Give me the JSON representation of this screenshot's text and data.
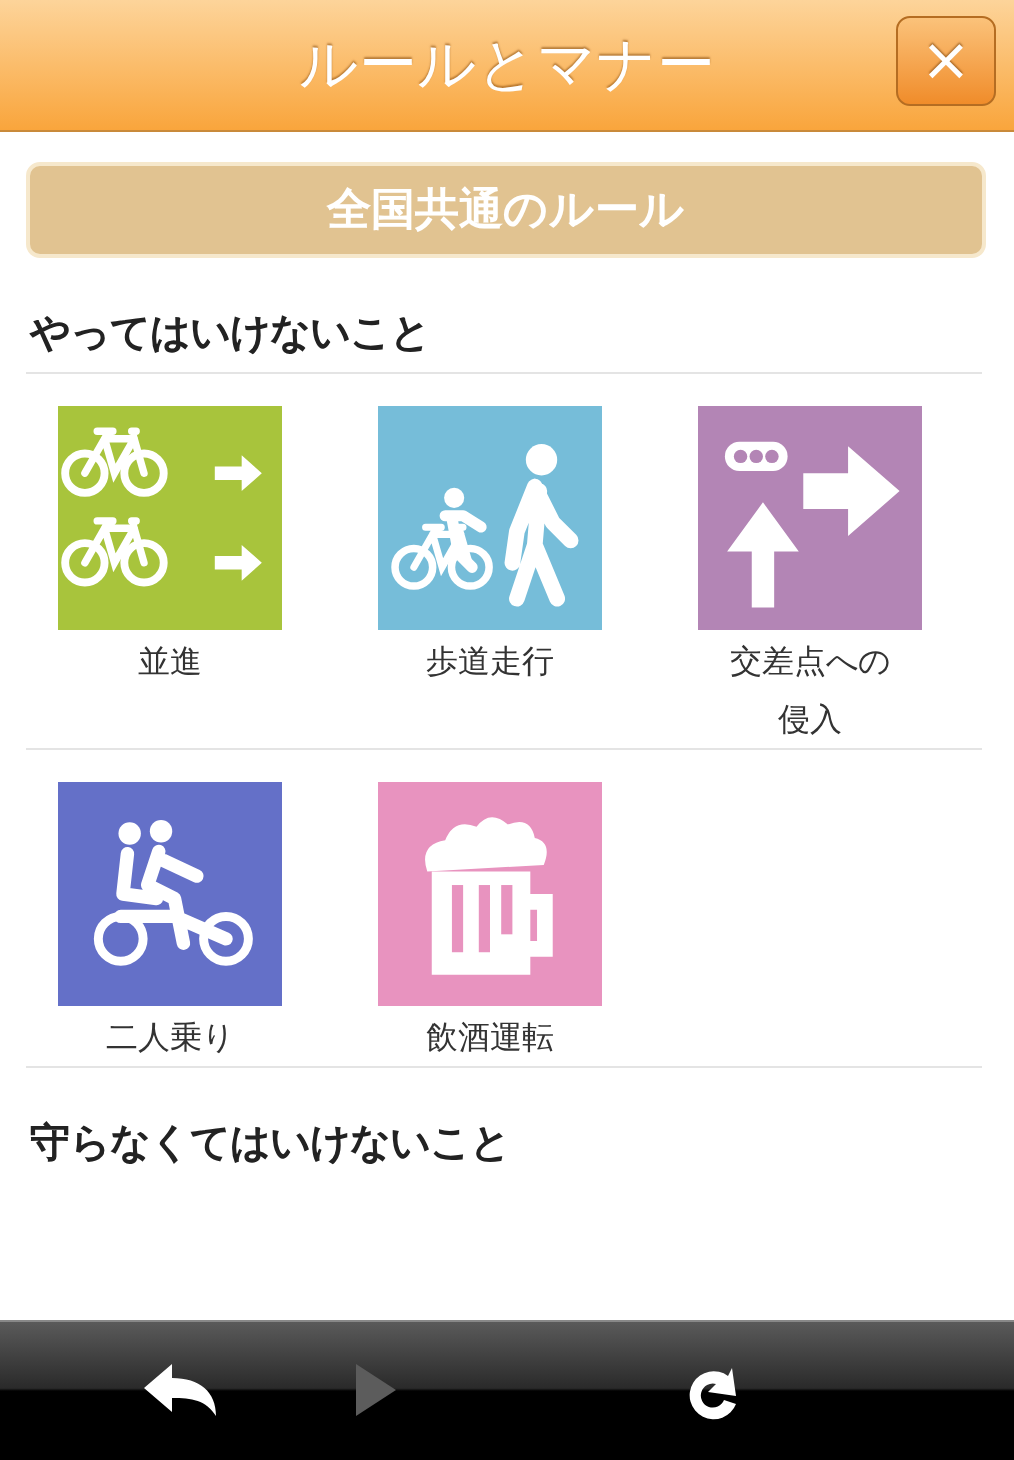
{
  "header": {
    "title": "ルールとマナー",
    "close_button": "×"
  },
  "section_bar": {
    "label": "全国共通のルール"
  },
  "sections": [
    {
      "heading": "やってはいけないこと",
      "items": [
        {
          "label": "並進",
          "kind": "parallel",
          "color": "#a8c43c"
        },
        {
          "label": "歩道走行",
          "kind": "sidewalk",
          "color": "#76bdd9"
        },
        {
          "label": "交差点への侵入",
          "kind": "intersection",
          "color": "#b385b5"
        },
        {
          "label": "二人乗り",
          "kind": "tandem",
          "color": "#6470c8"
        },
        {
          "label": "飲酒運転",
          "kind": "beer",
          "color": "#e893bf"
        }
      ]
    },
    {
      "heading": "守らなくてはいけないこと"
    }
  ],
  "toolbar": [
    {
      "kind": "back",
      "disabled": false
    },
    {
      "kind": "forward",
      "disabled": true
    },
    {
      "kind": "reload",
      "disabled": false
    }
  ]
}
